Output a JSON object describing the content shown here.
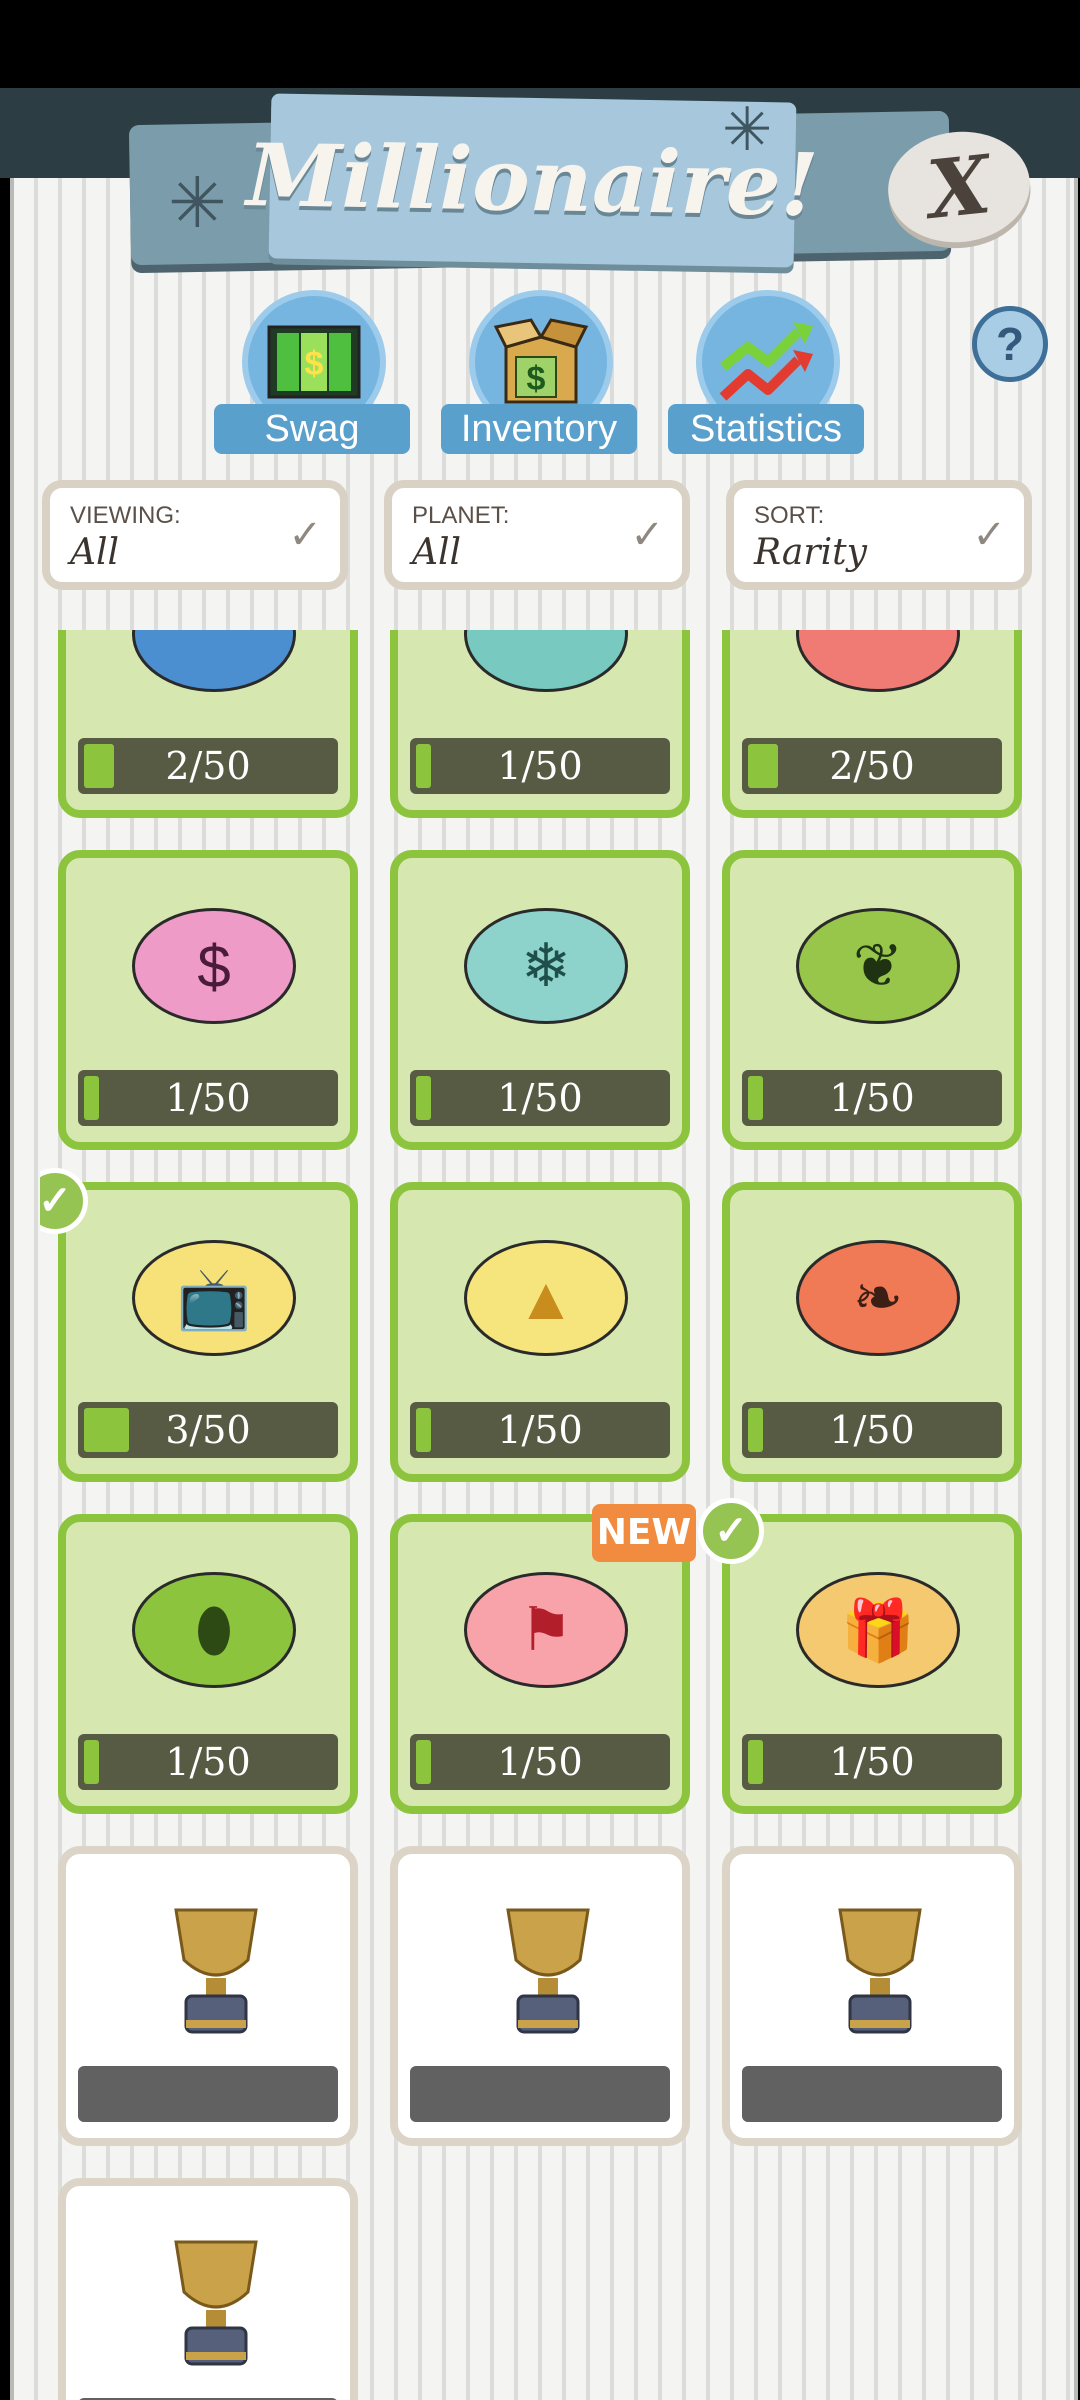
{
  "header": {
    "title": "Millionaire!",
    "close_label": "X",
    "help_label": "?"
  },
  "tabs": [
    {
      "label": "Swag",
      "icon": "money-door-icon"
    },
    {
      "label": "Inventory",
      "icon": "money-box-icon"
    },
    {
      "label": "Statistics",
      "icon": "trend-arrows-icon"
    }
  ],
  "filters": [
    {
      "caption": "VIEWING:",
      "value": "All"
    },
    {
      "caption": "PLANET:",
      "value": "All"
    },
    {
      "caption": "SORT:",
      "value": "Rarity"
    }
  ],
  "items": [
    {
      "progress": "2/50",
      "fraction": 0.04,
      "icon": "partial-blue-icon",
      "color": "#4b8fd1"
    },
    {
      "progress": "1/50",
      "fraction": 0.02,
      "icon": "partial-teal-icon",
      "color": "#78c9bf"
    },
    {
      "progress": "2/50",
      "fraction": 0.04,
      "icon": "partial-red-icon",
      "color": "#f07a74"
    },
    {
      "progress": "1/50",
      "fraction": 0.02,
      "icon": "dollar-sign-icon",
      "color": "#ee9bc8"
    },
    {
      "progress": "1/50",
      "fraction": 0.02,
      "icon": "snowflake-icon",
      "color": "#8dd2cb"
    },
    {
      "progress": "1/50",
      "fraction": 0.02,
      "icon": "holly-icon",
      "color": "#97c64a"
    },
    {
      "progress": "3/50",
      "fraction": 0.06,
      "icon": "television-icon",
      "color": "#f7e27a",
      "checked": true
    },
    {
      "progress": "1/50",
      "fraction": 0.02,
      "icon": "party-hat-icon",
      "color": "#f6e47c"
    },
    {
      "progress": "1/50",
      "fraction": 0.02,
      "icon": "leaf-icon",
      "color": "#f07a55"
    },
    {
      "progress": "1/50",
      "fraction": 0.02,
      "icon": "football-icon",
      "color": "#8cc43e"
    },
    {
      "progress": "1/50",
      "fraction": 0.02,
      "icon": "flag-icon",
      "color": "#f8a2aa",
      "new_label": "NEW"
    },
    {
      "progress": "1/50",
      "fraction": 0.02,
      "icon": "gift-icon",
      "color": "#f4c970",
      "checked": true
    }
  ],
  "locked": [
    {
      "icon": "trophy-icon"
    },
    {
      "icon": "trophy-icon"
    },
    {
      "icon": "trophy-icon"
    },
    {
      "icon": "trophy-icon"
    }
  ]
}
